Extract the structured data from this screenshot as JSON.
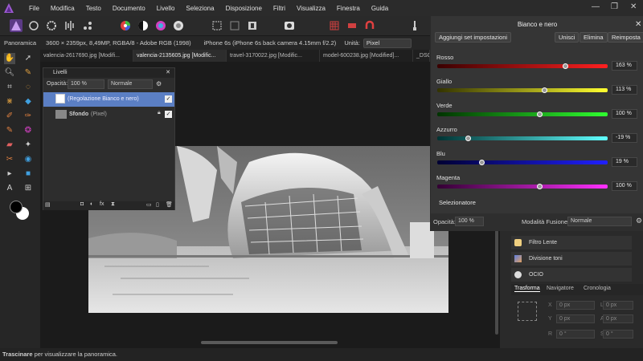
{
  "menu": {
    "items": [
      "File",
      "Modifica",
      "Testo",
      "Documento",
      "Livello",
      "Seleziona",
      "Disposizione",
      "Filtri",
      "Visualizza",
      "Finestra",
      "Guida"
    ]
  },
  "context": {
    "tool_name": "Panoramica",
    "doc_info": "3600 × 2359px, 8,49MP, RGBA/8 - Adobe RGB (1998)",
    "camera": "iPhone 6s (iPhone 6s back camera 4.15mm f/2.2)",
    "unit_label": "Unità:",
    "unit_value": "Pixel"
  },
  "tabs": [
    "valencia-2617690.jpg [Modifi...",
    "valencia-2135605.jpg [Modific...",
    "travel-3170022.jpg [Modific...",
    "model-600238.jpg [Modified]...",
    "_DSC"
  ],
  "layers": {
    "title": "Livelli",
    "opacity_label": "Opacità:",
    "opacity_value": "100 %",
    "blend_value": "Normale",
    "items": [
      {
        "name": "(Regolazione Bianco e nero)"
      },
      {
        "name": "Sfondo",
        "suffix": "(Pixel)"
      }
    ]
  },
  "adjustment": {
    "title": "Bianco e nero",
    "preset_button": "Aggiungi set impostazioni",
    "merge_button": "Unisci",
    "delete_button": "Elimina",
    "reset_button": "Reimposta",
    "sliders": [
      {
        "label": "Rosso",
        "value": "163 %",
        "pos": 0.75,
        "color_from": "#3a0000",
        "color_to": "#ff2020"
      },
      {
        "label": "Giallo",
        "value": "113 %",
        "pos": 0.63,
        "color_from": "#333300",
        "color_to": "#ffff30"
      },
      {
        "label": "Verde",
        "value": "100 %",
        "pos": 0.6,
        "color_from": "#003300",
        "color_to": "#30ff30"
      },
      {
        "label": "Azzurro",
        "value": "-19 %",
        "pos": 0.18,
        "color_from": "#003333",
        "color_to": "#60ffff"
      },
      {
        "label": "Blu",
        "value": "19 %",
        "pos": 0.26,
        "color_from": "#000033",
        "color_to": "#2020ff"
      },
      {
        "label": "Magenta",
        "value": "100 %",
        "pos": 0.6,
        "color_from": "#330033",
        "color_to": "#ff30ff"
      }
    ],
    "picker_button": "Selezionatore",
    "opacity_label": "Opacità:",
    "opacity_value": "100 %",
    "blend_label": "Modalità Fusione:",
    "blend_value": "Normale"
  },
  "effects": {
    "items": [
      "Filtro Lente",
      "Divisione toni",
      "OCIO"
    ]
  },
  "bottom_tabs": [
    "Trasforma",
    "Navigatore",
    "Cronologia"
  ],
  "transform": {
    "x_label": "X",
    "x_value": "0 px",
    "y_label": "Y",
    "y_value": "0 px",
    "w_label": "L",
    "w_value": "0 px",
    "h_label": "A",
    "h_value": "0 px",
    "r_label": "R",
    "r_value": "0 °",
    "s_label": "S",
    "s_value": "0 °"
  },
  "status": {
    "bold": "Trascinare",
    "text": " per visualizzare la panoramica."
  }
}
